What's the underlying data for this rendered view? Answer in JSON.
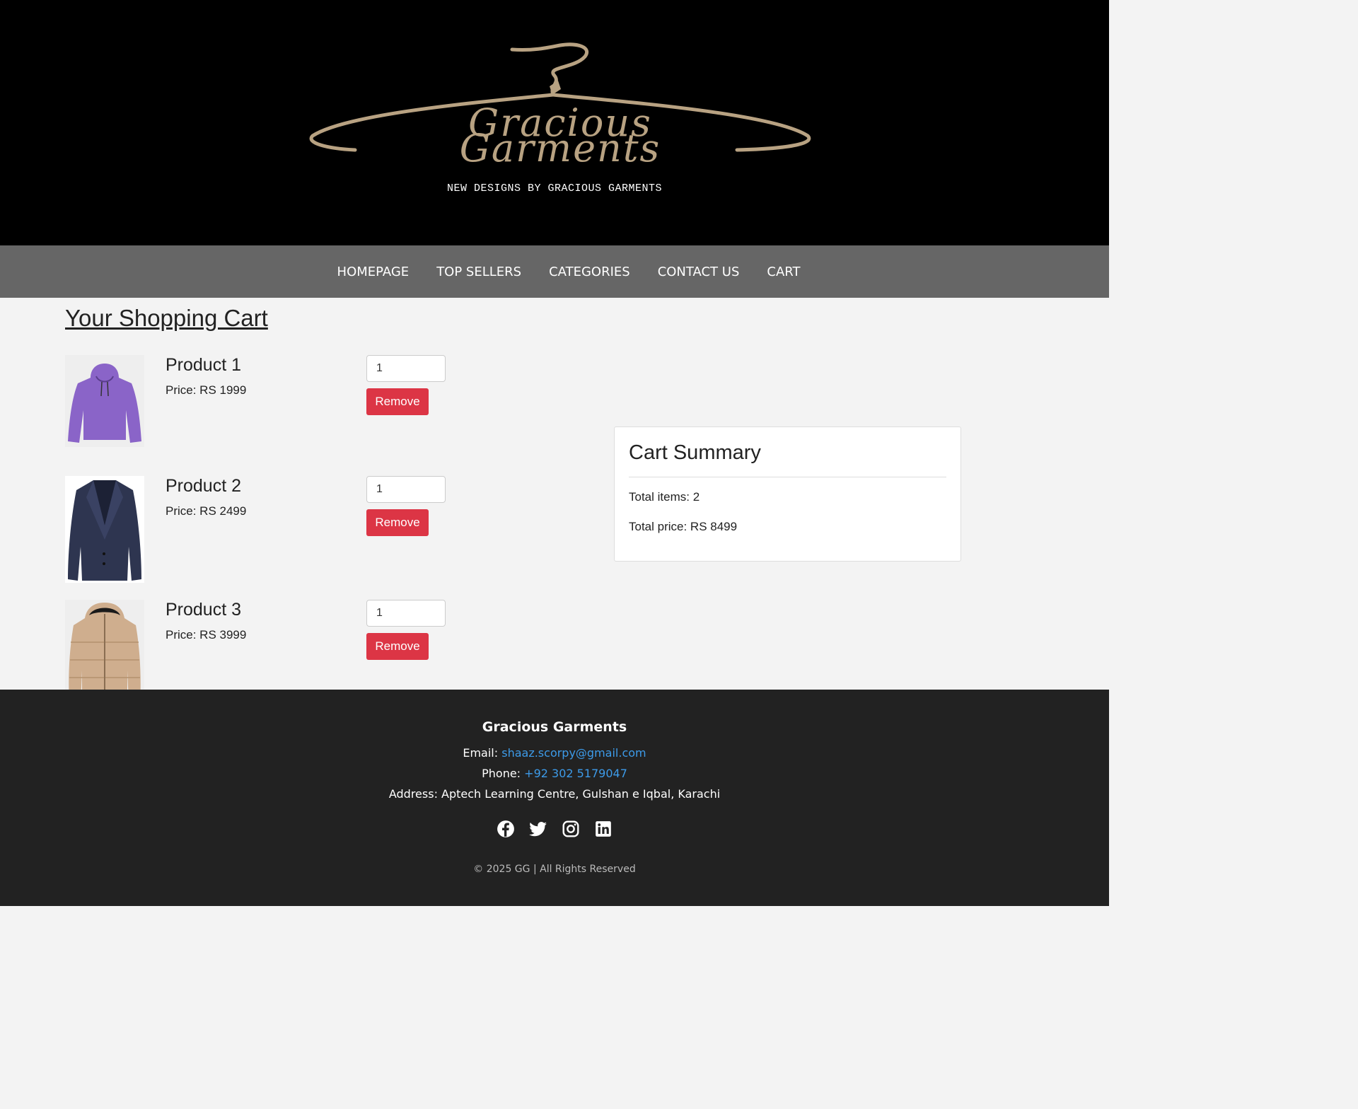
{
  "header": {
    "logo_text_line1": "Gracious",
    "logo_text_line2": "Garments",
    "tagline": "NEW DESIGNS BY GRACIOUS GARMENTS"
  },
  "nav": {
    "items": [
      "HOMEPAGE",
      "TOP SELLERS",
      "CATEGORIES",
      "CONTACT US",
      "CART"
    ]
  },
  "cart": {
    "title": "Your Shopping Cart",
    "remove_label": "Remove",
    "items": [
      {
        "name": "Product 1",
        "price": "Price: RS 1999",
        "quantity": "1",
        "image": "purple-hoodie-image"
      },
      {
        "name": "Product 2",
        "price": "Price: RS 2499",
        "quantity": "1",
        "image": "navy-blazer-image"
      },
      {
        "name": "Product 3",
        "price": "Price: RS 3999",
        "quantity": "1",
        "image": "beige-puffer-jacket-image"
      }
    ]
  },
  "summary": {
    "title": "Cart Summary",
    "total_items": "Total items: 2",
    "total_price": "Total price: RS 8499"
  },
  "footer": {
    "brand": "Gracious Garments",
    "email_label": "Email:",
    "email": "shaaz.scorpy@gmail.com",
    "phone_label": "Phone:",
    "phone": "+92 302 5179047",
    "address": "Address: Aptech Learning Centre, Gulshan e Iqbal, Karachi",
    "socials": [
      "facebook-icon",
      "twitter-icon",
      "instagram-icon",
      "linkedin-icon"
    ],
    "copyright": "© 2025 GG | All Rights Reserved"
  },
  "colors": {
    "logo_gold": "#b8a282",
    "remove_red": "#dc3545",
    "link_blue": "#3d9be9",
    "nav_gray": "#666666",
    "footer_dark": "#222222"
  }
}
